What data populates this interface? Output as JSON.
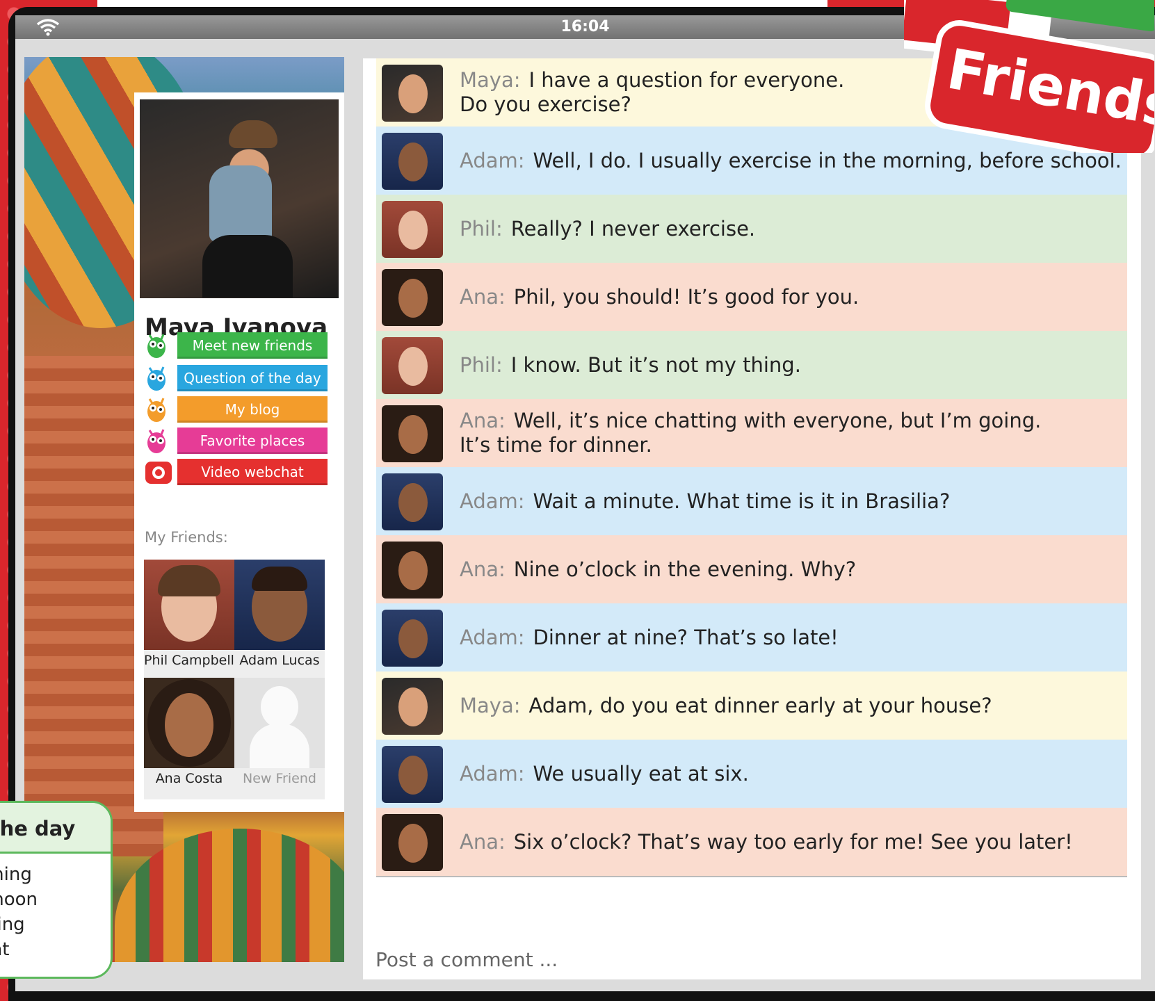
{
  "status": {
    "time": "16:04"
  },
  "profile": {
    "name": "Maya Ivanova",
    "menu": [
      {
        "label": "Meet new friends",
        "color": "#3cb54a",
        "icon": "monster-green-icon"
      },
      {
        "label": "Question of the day",
        "color": "#29a6df",
        "icon": "monster-blue-icon"
      },
      {
        "label": "My blog",
        "color": "#f39c2b",
        "icon": "monster-orange-icon"
      },
      {
        "label": "Favorite places",
        "color": "#e63c96",
        "icon": "monster-pink-icon"
      },
      {
        "label": "Video webchat",
        "color": "#e5302f",
        "icon": "camera-icon"
      }
    ],
    "friends_label": "My Friends:",
    "friends": [
      {
        "name": "Phil Campbell"
      },
      {
        "name": "Adam Lucas"
      },
      {
        "name": "Ana Costa"
      },
      {
        "name": "New Friend"
      }
    ]
  },
  "question_box": {
    "title": "f the day",
    "options": [
      "orning",
      "ernoon",
      "ening",
      "ight"
    ]
  },
  "badge": {
    "text": "Friends"
  },
  "chat": {
    "messages": [
      {
        "who": "Maya:",
        "line1": "I have a question for everyone.",
        "line2": "Do you exercise?",
        "color": "#fdf8dc"
      },
      {
        "who": "Adam:",
        "line1": "Well, I do. I usually exercise in the morning, before school.",
        "line2": "",
        "color": "#d3eaf9"
      },
      {
        "who": "Phil:",
        "line1": "Really? I never exercise.",
        "line2": "",
        "color": "#dcecd6"
      },
      {
        "who": "Ana:",
        "line1": "Phil, you should! It’s good for you.",
        "line2": "",
        "color": "#fadccf"
      },
      {
        "who": "Phil:",
        "line1": "I know. But it’s not my thing.",
        "line2": "",
        "color": "#dcecd6"
      },
      {
        "who": "Ana:",
        "line1": "Well, it’s nice chatting with everyone, but I’m going.",
        "line2": "It’s time for dinner.",
        "color": "#fadccf"
      },
      {
        "who": "Adam:",
        "line1": "Wait a minute. What time is it in Brasilia?",
        "line2": "",
        "color": "#d3eaf9"
      },
      {
        "who": "Ana:",
        "line1": "Nine o’clock in the evening. Why?",
        "line2": "",
        "color": "#fadccf"
      },
      {
        "who": "Adam:",
        "line1": "Dinner at nine? That’s so late!",
        "line2": "",
        "color": "#d3eaf9"
      },
      {
        "who": "Maya:",
        "line1": "Adam, do you eat dinner early at your house?",
        "line2": "",
        "color": "#fdf8dc"
      },
      {
        "who": "Adam:",
        "line1": "We usually eat at six.",
        "line2": "",
        "color": "#d3eaf9"
      },
      {
        "who": "Ana:",
        "line1": "Six o’clock? That’s way too early for me! See you later!",
        "line2": "",
        "color": "#fadccf"
      }
    ],
    "comment_placeholder": "Post a comment ..."
  }
}
